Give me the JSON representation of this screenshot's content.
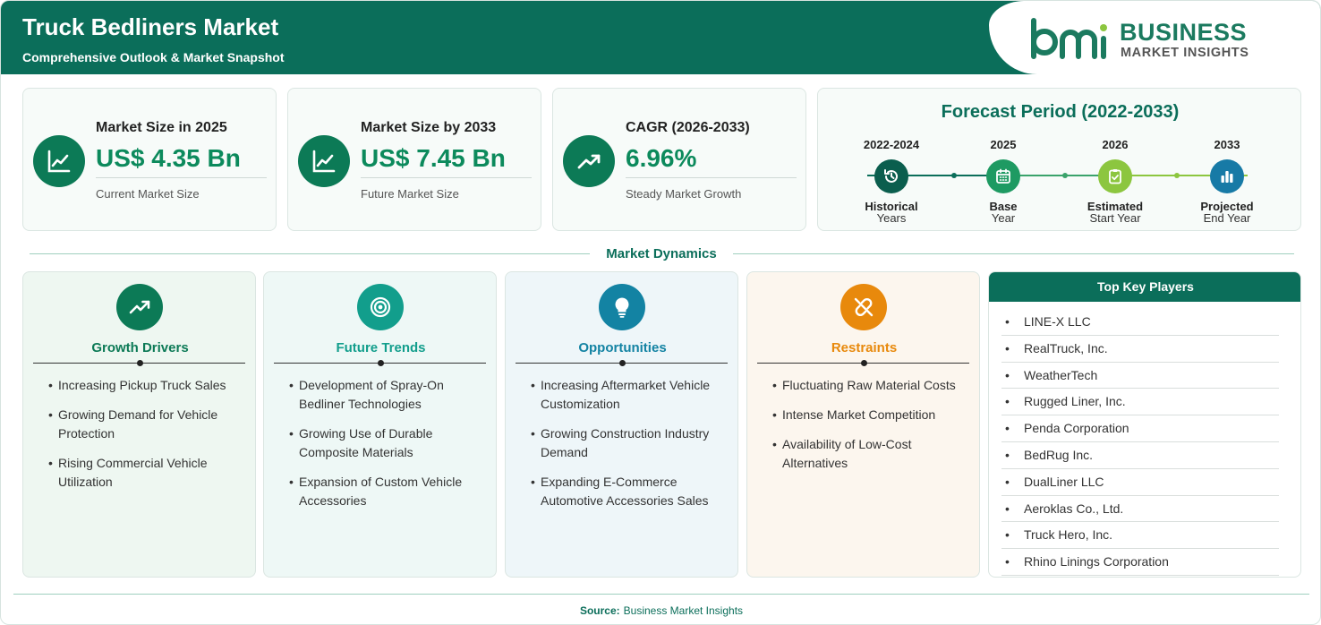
{
  "header": {
    "title": "Truck Bedliners Market",
    "subtitle": "Comprehensive Outlook & Market Snapshot",
    "logo_word1": "BUSINESS",
    "logo_word2": "MARKET INSIGHTS"
  },
  "stats": [
    {
      "label": "Market Size in 2025",
      "value": "US$ 4.35 Bn",
      "sub": "Current Market Size",
      "icon": "line-chart-icon"
    },
    {
      "label": "Market Size by 2033",
      "value": "US$ 7.45 Bn",
      "sub": "Future Market Size",
      "icon": "line-chart-icon"
    },
    {
      "label": "CAGR (2026-2033)",
      "value": "6.96%",
      "sub": "Steady Market Growth",
      "icon": "trending-up-icon"
    }
  ],
  "forecast": {
    "title": "Forecast Period (2022-2033)",
    "points": [
      {
        "year": "2022-2024",
        "line1": "Historical",
        "line2": "Years",
        "icon": "history-icon",
        "color": "#0b5e4e"
      },
      {
        "year": "2025",
        "line1": "Base",
        "line2": "Year",
        "icon": "calendar-icon",
        "color": "#1e9a62"
      },
      {
        "year": "2026",
        "line1": "Estimated",
        "line2": "Start Year",
        "icon": "clipboard-check-icon",
        "color": "#8cc63f"
      },
      {
        "year": "2033",
        "line1": "Projected",
        "line2": "End Year",
        "icon": "bar-chart-icon",
        "color": "#177aa6"
      }
    ]
  },
  "dynamics": {
    "title": "Market Dynamics",
    "cards": [
      {
        "title": "Growth Drivers",
        "color": "#0c7a56",
        "bg": "#eef7f1",
        "icon": "trending-up-icon",
        "items": [
          "Increasing Pickup Truck Sales",
          "Growing Demand for Vehicle Protection",
          "Rising Commercial Vehicle Utilization"
        ]
      },
      {
        "title": "Future Trends",
        "color": "#129e8c",
        "bg": "#eef8f6",
        "icon": "target-icon",
        "items": [
          "Development of Spray-On Bedliner Technologies",
          "Growing Use of Durable Composite Materials",
          "Expansion of Custom Vehicle Accessories"
        ]
      },
      {
        "title": "Opportunities",
        "color": "#1383a3",
        "bg": "#eef6f9",
        "icon": "lightbulb-icon",
        "items": [
          "Increasing Aftermarket Vehicle Customization",
          "Growing Construction Industry Demand",
          "Expanding E-Commerce Automotive Accessories Sales"
        ]
      },
      {
        "title": "Restraints",
        "color": "#e8890c",
        "bg": "#fcf6ee",
        "icon": "broken-link-icon",
        "items": [
          "Fluctuating Raw Material Costs",
          "Intense Market Competition",
          "Availability of Low-Cost Alternatives"
        ]
      }
    ]
  },
  "players": {
    "title": "Top Key Players",
    "items": [
      "LINE-X LLC",
      "RealTruck, Inc.",
      "WeatherTech",
      "Rugged Liner, Inc.",
      "Penda Corporation",
      "BedRug Inc.",
      "DualLiner LLC",
      "Aeroklas Co., Ltd.",
      "Truck Hero, Inc.",
      "Rhino Linings Corporation"
    ]
  },
  "footer": {
    "source_label": "Source:",
    "source_value": "Business Market Insights"
  }
}
